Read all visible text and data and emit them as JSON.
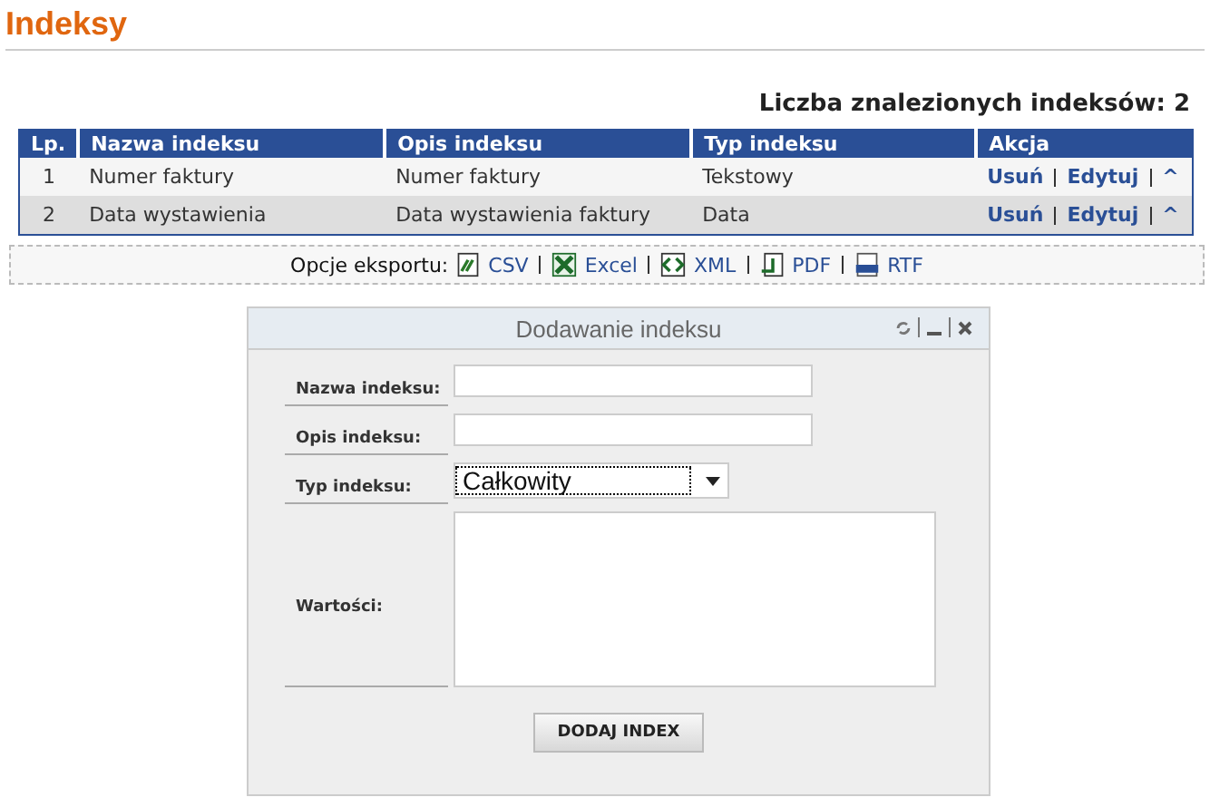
{
  "page_title": "Indeksy",
  "result_count": "Liczba znalezionych indeksów: 2",
  "table": {
    "columns": [
      "Lp.",
      "Nazwa indeksu",
      "Opis indeksu",
      "Typ indeksu",
      "Akcja"
    ],
    "rows": [
      {
        "lp": "1",
        "name": "Numer faktury",
        "description": "Numer faktury",
        "type": "Tekstowy",
        "actions": [
          "Usuń",
          "Edytuj",
          "^"
        ]
      },
      {
        "lp": "2",
        "name": "Data wystawienia",
        "description": "Data wystawienia faktury",
        "type": "Data",
        "actions": [
          "Usuń",
          "Edytuj",
          "^"
        ]
      }
    ]
  },
  "export": {
    "label": "Opcje eksportu:",
    "options": [
      {
        "kind": "csv",
        "label": "CSV"
      },
      {
        "kind": "excel",
        "label": "Excel"
      },
      {
        "kind": "xml",
        "label": "XML"
      },
      {
        "kind": "pdf",
        "label": "PDF"
      },
      {
        "kind": "rtf",
        "label": "RTF"
      }
    ]
  },
  "dialog": {
    "title": "Dodawanie indeksu",
    "fields": [
      {
        "kind": "text",
        "label": "Nazwa indeksu:"
      },
      {
        "kind": "text",
        "label": "Opis indeksu:"
      },
      {
        "kind": "select",
        "label": "Typ indeksu:",
        "value": "Całkowity"
      },
      {
        "kind": "textarea",
        "label": "Wartości:"
      }
    ],
    "button": "DODAJ INDEX"
  }
}
